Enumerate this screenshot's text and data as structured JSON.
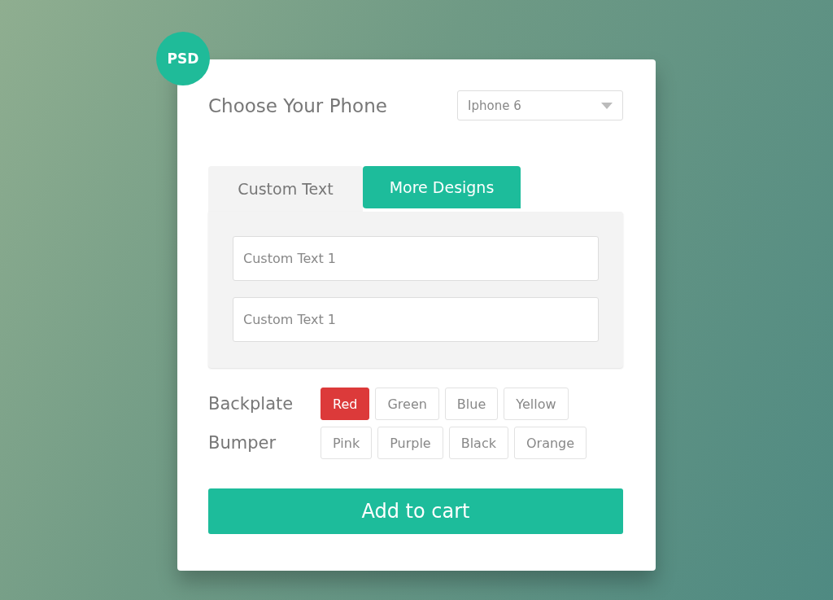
{
  "badge": "PSD",
  "phone": {
    "label": "Choose Your Phone",
    "value": "Iphone 6"
  },
  "tabs": [
    {
      "label": "Custom Text",
      "selected": false
    },
    {
      "label": "More Designs",
      "selected": true
    }
  ],
  "fields": [
    {
      "placeholder": "Custom Text 1"
    },
    {
      "placeholder": "Custom Text 1"
    }
  ],
  "option_groups": [
    {
      "label": "Backplate",
      "options": [
        {
          "label": "Red",
          "selected": true
        },
        {
          "label": "Green",
          "selected": false
        },
        {
          "label": "Blue",
          "selected": false
        },
        {
          "label": "Yellow",
          "selected": false
        }
      ]
    },
    {
      "label": "Bumper",
      "options": [
        {
          "label": "Pink",
          "selected": false
        },
        {
          "label": "Purple",
          "selected": false
        },
        {
          "label": "Black",
          "selected": false
        },
        {
          "label": "Orange",
          "selected": false
        }
      ]
    }
  ],
  "add_button": "Add to cart"
}
